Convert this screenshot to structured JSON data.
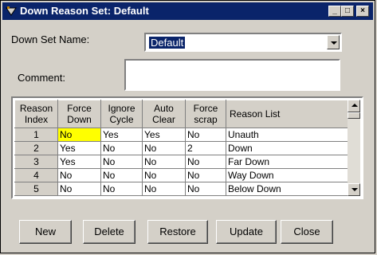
{
  "window": {
    "title": "Down Reason Set:  Default",
    "controls": {
      "minimize": "_",
      "maximize": "□",
      "close": "×"
    }
  },
  "form": {
    "set_name_label": "Down Set Name:",
    "set_name_value": "Default",
    "comment_label": "Comment:",
    "comment_value": ""
  },
  "grid": {
    "columns": [
      "Reason\nIndex",
      "Force\nDown",
      "Ignore\nCycle",
      "Auto\nClear",
      "Force\nscrap",
      "Reason List"
    ],
    "rows": [
      [
        "1",
        "No",
        "Yes",
        "Yes",
        "No",
        "Unauth"
      ],
      [
        "2",
        "Yes",
        "No",
        "No",
        "2",
        "Down"
      ],
      [
        "3",
        "Yes",
        "No",
        "No",
        "No",
        "Far Down"
      ],
      [
        "4",
        "No",
        "No",
        "No",
        "No",
        "Way Down"
      ],
      [
        "5",
        "No",
        "No",
        "No",
        "No",
        "Below Down"
      ]
    ],
    "highlight_color": "#ffff00"
  },
  "buttons": {
    "new": "New",
    "delete": "Delete",
    "restore": "Restore",
    "update": "Update",
    "close": "Close"
  },
  "colors": {
    "titlebar": "#0a246a",
    "face": "#d4d0c8"
  }
}
